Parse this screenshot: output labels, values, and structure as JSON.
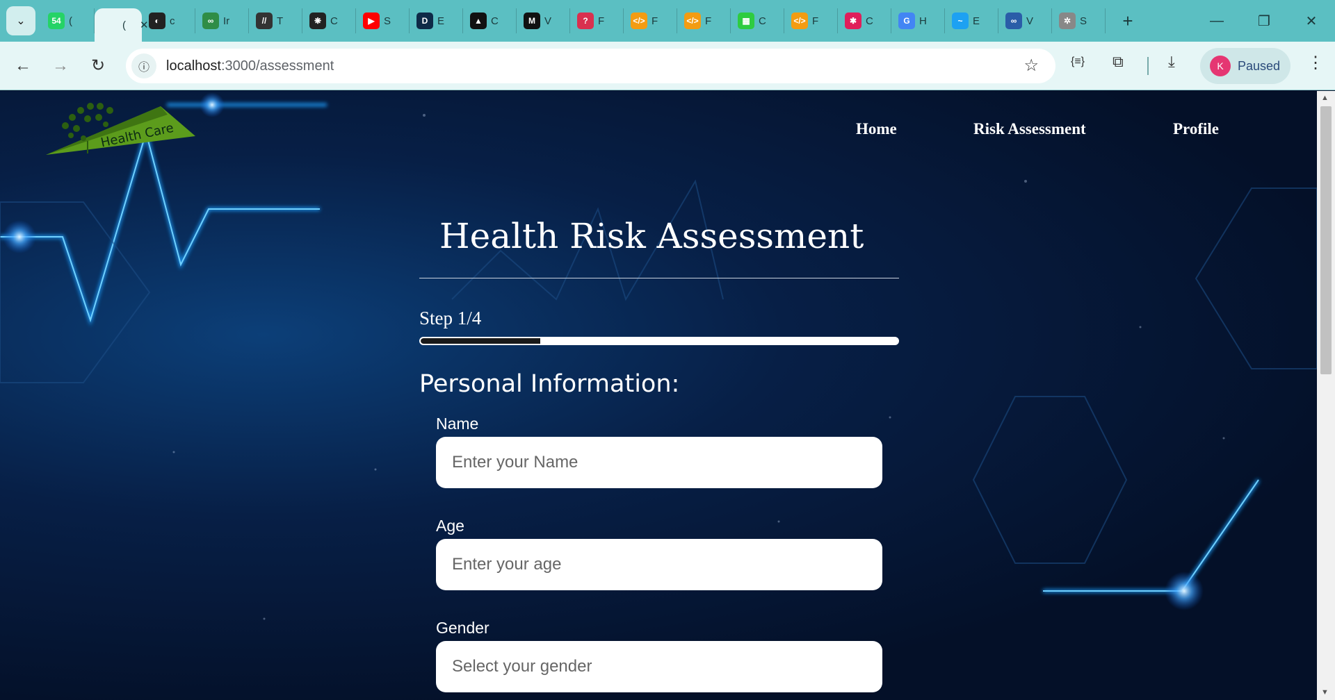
{
  "browser": {
    "tabs": [
      {
        "icon": "whatsapp-icon",
        "fav": "54",
        "label": "(",
        "color": "#25d366"
      },
      {
        "icon": "active-tab-icon",
        "fav": "",
        "label": "(",
        "color": "#e6f6f6",
        "active": true
      },
      {
        "icon": "github-icon",
        "fav": "◐",
        "label": "c",
        "color": "#222"
      },
      {
        "icon": "geeksforgeeks-icon",
        "fav": "∞",
        "label": "Ir",
        "color": "#2f8d46"
      },
      {
        "icon": "slash-icon",
        "fav": "//",
        "label": "T",
        "color": "#333"
      },
      {
        "icon": "chatgpt-icon",
        "fav": "❋",
        "label": "C",
        "color": "#222"
      },
      {
        "icon": "youtube-icon",
        "fav": "▶",
        "label": "S",
        "color": "#ff0000"
      },
      {
        "icon": "d-icon",
        "fav": "D",
        "label": "E",
        "color": "#0e2a47"
      },
      {
        "icon": "triangle-icon",
        "fav": "▲",
        "label": "C",
        "color": "#111"
      },
      {
        "icon": "medium-icon",
        "fav": "M",
        "label": "V",
        "color": "#111"
      },
      {
        "icon": "question-icon",
        "fav": "?",
        "label": "F",
        "color": "#d9304f"
      },
      {
        "icon": "code-icon",
        "fav": "</>",
        "label": "F",
        "color": "#f39c12"
      },
      {
        "icon": "code-icon",
        "fav": "</>",
        "label": "F",
        "color": "#f39c12"
      },
      {
        "icon": "green-app-icon",
        "fav": "▦",
        "label": "C",
        "color": "#2ecc40"
      },
      {
        "icon": "code-icon",
        "fav": "</>",
        "label": "F",
        "color": "#f39c12"
      },
      {
        "icon": "slack-icon",
        "fav": "✱",
        "label": "C",
        "color": "#e01e5a"
      },
      {
        "icon": "google-icon",
        "fav": "G",
        "label": "H",
        "color": "#4285f4"
      },
      {
        "icon": "bird-icon",
        "fav": "~",
        "label": "E",
        "color": "#1da1f2"
      },
      {
        "icon": "link-icon",
        "fav": "∞",
        "label": "V",
        "color": "#2a5da8"
      },
      {
        "icon": "image-icon",
        "fav": "✲",
        "label": "S",
        "color": "#888"
      }
    ],
    "new_tab": "+",
    "window_controls": {
      "minimize": "—",
      "restore": "❐",
      "close": "✕"
    },
    "tab_search": "⌄",
    "nav": {
      "back": "←",
      "forward": "→",
      "reload": "↻"
    },
    "url_host": "localhost",
    "url_path": ":3000/assessment",
    "site_info": "ⓘ",
    "bookmark": "☆",
    "extension_glyph": "{≡}",
    "puzzle_glyph": "⧉",
    "download_glyph": "⤓",
    "menu_glyph": "⋮",
    "profile": {
      "initial": "K",
      "status": "Paused",
      "avatar_color": "#e53672"
    }
  },
  "site": {
    "logo_text": "Health Care",
    "nav": [
      "Home",
      "Risk Assessment",
      "Profile"
    ],
    "title": "Health Risk Assessment",
    "step_text": "Step 1/4",
    "progress": 0.25,
    "section_title": "Personal Information:",
    "fields": [
      {
        "label": "Name",
        "placeholder": "Enter your Name"
      },
      {
        "label": "Age",
        "placeholder": "Enter your age"
      },
      {
        "label": "Gender",
        "placeholder": "Select your gender"
      }
    ]
  }
}
